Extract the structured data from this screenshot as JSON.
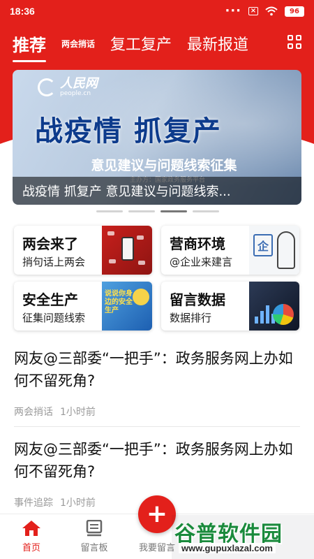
{
  "status_bar": {
    "time": "18:36",
    "battery": "96",
    "colors": {
      "bg": "#e3201b"
    }
  },
  "tabs": [
    {
      "label": "推荐",
      "active": true
    },
    {
      "label": "两会捎话",
      "active": false
    },
    {
      "label": "复工复产",
      "active": false
    },
    {
      "label": "最新报道",
      "active": false
    }
  ],
  "tabs_menu_icon": "grid-icon",
  "banner": {
    "logo_text": "人民网",
    "logo_sub": "people.cn",
    "headline": "战疫情 抓复产",
    "subheadline": "意见建议与问题线索征集",
    "host": "主办方：国家政务服务平台",
    "caption": "战疫情 抓复产 意见建议与问题线索...",
    "slide_count": 4,
    "active_slide": 3
  },
  "cards": [
    {
      "title": "两会来了",
      "subtitle": "捎句话上两会",
      "image": "red-poster"
    },
    {
      "title": "营商环境",
      "subtitle": "@企业来建言",
      "image": "sketch-enterprise",
      "image_text": "企"
    },
    {
      "title": "安全生产",
      "subtitle": "征集问题线索",
      "image": "blue-safety",
      "image_text": "说说你身边的安全生产"
    },
    {
      "title": "留言数据",
      "subtitle": "数据排行",
      "image": "dark-charts"
    }
  ],
  "news": [
    {
      "title": "网友@三部委“一把手”：政务服务网上办如何不留死角?",
      "source": "两会捎话",
      "time": "1小时前"
    },
    {
      "title": "网友@三部委“一把手”：政务服务网上办如何不留死角?",
      "source": "事件追踪",
      "time": "1小时前"
    }
  ],
  "bottom_nav": [
    {
      "label": "首页",
      "icon": "home-icon",
      "active": true
    },
    {
      "label": "留言板",
      "icon": "message-board-icon",
      "active": false
    },
    {
      "label": "我要留言",
      "icon": "plus-icon",
      "active": false
    }
  ],
  "fab_symbol": "+",
  "watermark": {
    "title": "谷普软件园",
    "url": "www.gupuxlazal.com"
  },
  "colors": {
    "accent": "#e3201b",
    "text": "#111111",
    "meta": "#9a9a9a"
  }
}
